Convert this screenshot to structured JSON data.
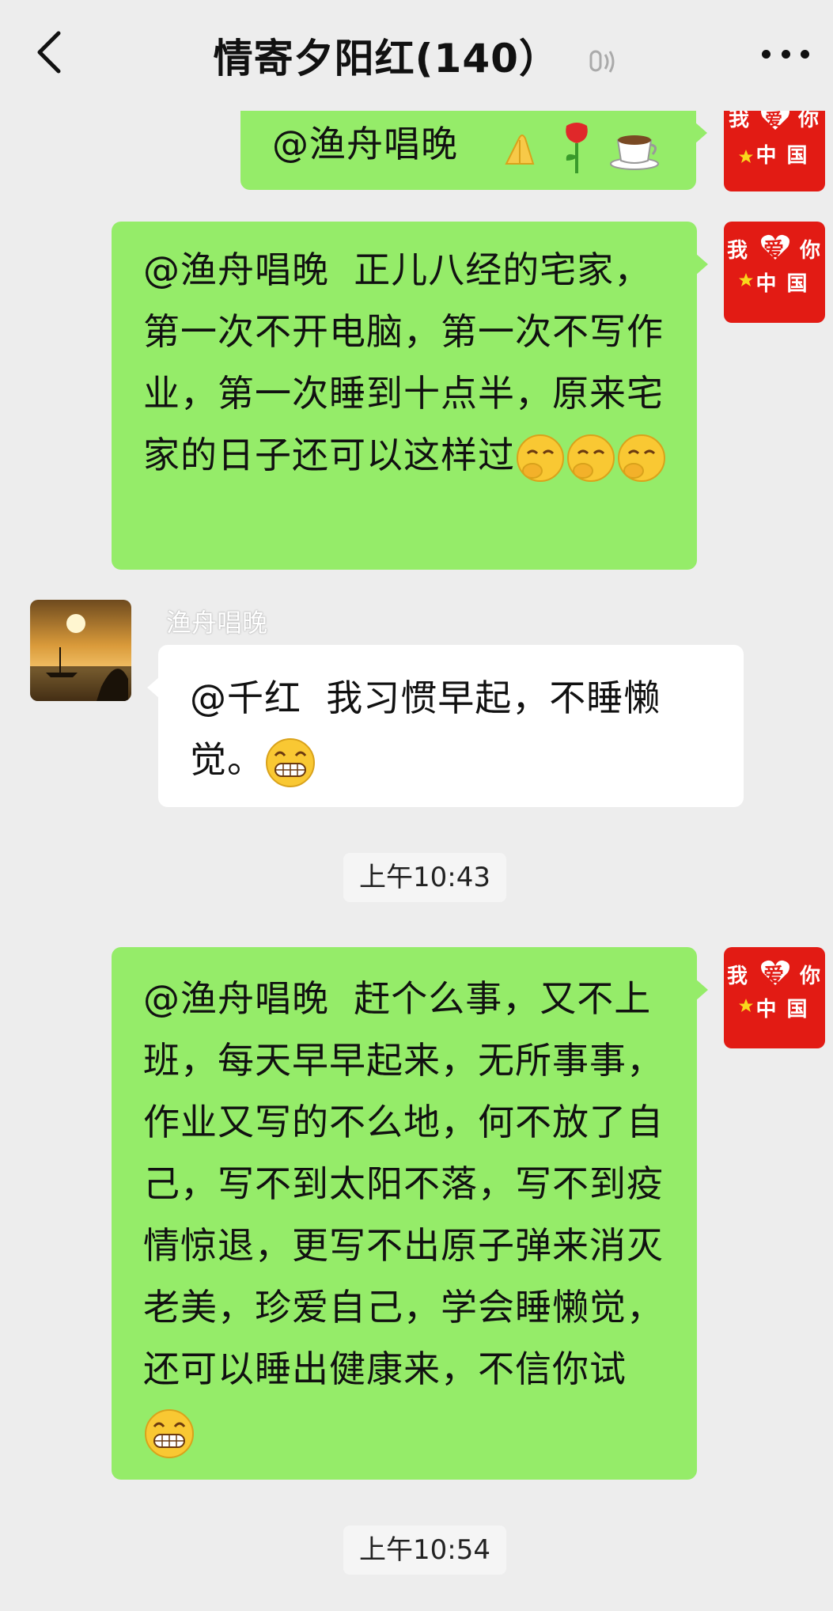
{
  "header": {
    "title": "情寄夕阳红(140）",
    "back_icon": "chevron-left-icon",
    "voice_icon": "ear-icon",
    "more_icon": "more-dots-icon"
  },
  "avatars": {
    "me": {
      "line1_left": "我",
      "line1_heart": "爱",
      "line1_right": "你",
      "line2": "中 国"
    }
  },
  "messages": [
    {
      "side": "right",
      "text": "@渔舟唱晚  ",
      "emojis": [
        "praying-hands-icon",
        "rose-icon",
        "coffee-icon"
      ]
    },
    {
      "side": "right",
      "text": "@渔舟唱晚  正儿八经的宅家，第一次不开电脑，第一次不写作业，第一次睡到十点半，原来宅家的日子还可以这样过",
      "emojis": [
        "giggle-icon",
        "giggle-icon",
        "giggle-icon"
      ]
    },
    {
      "side": "left",
      "sender": "渔舟唱晚",
      "text": "@千红  我习惯早起，不睡懒觉。",
      "emojis": [
        "grin-icon"
      ]
    },
    {
      "side": "right",
      "text": "@渔舟唱晚  赶个么事，又不上班，每天早早起来，无所事事，作业又写的不么地，何不放了自己，写不到太阳不落，写不到疫情惊退，更写不出原子弹来消灭老美，珍爱自己，学会睡懒觉，还可以睡出健康来，不信你试",
      "emojis": [
        "grin-icon"
      ]
    }
  ],
  "timestamps": [
    "上午10:43",
    "上午10:54"
  ],
  "colors": {
    "bubble_green": "#95ec69",
    "bubble_white": "#ffffff",
    "background": "#ededed",
    "avatar_red": "#e21b14"
  }
}
